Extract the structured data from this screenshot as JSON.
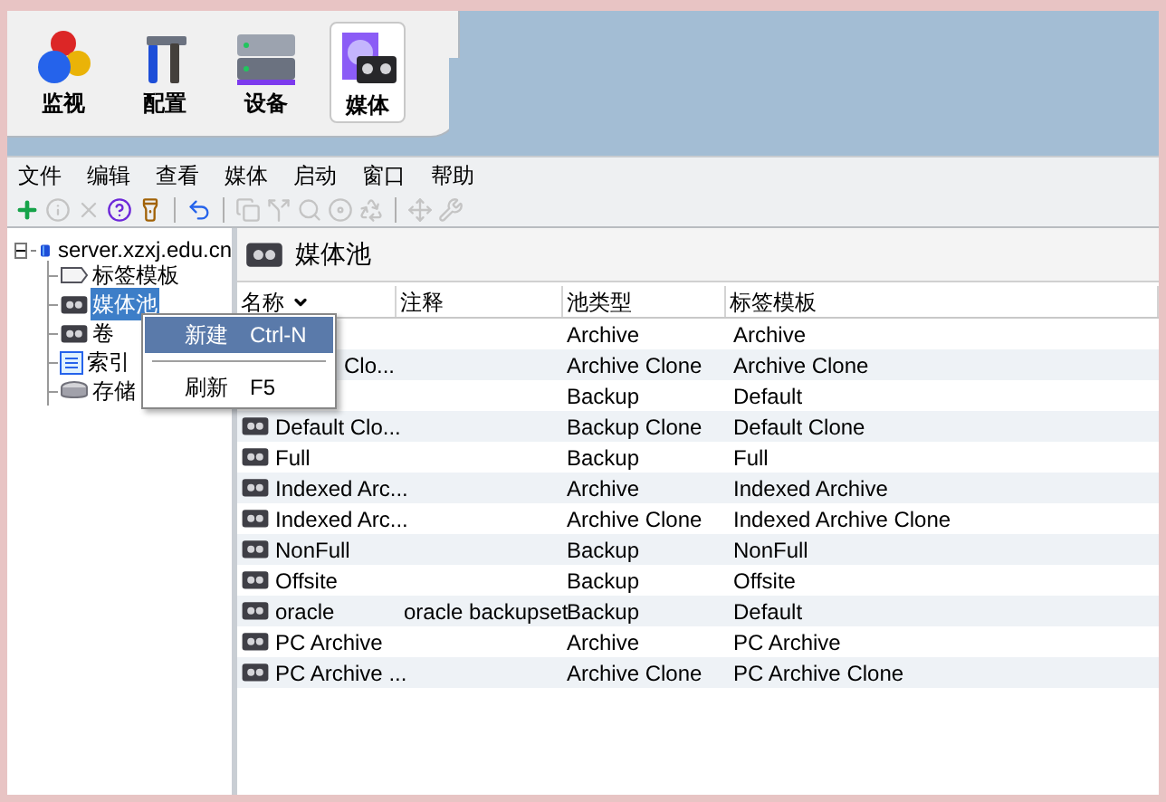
{
  "nav": [
    {
      "label": "监视",
      "kind": "monitor",
      "selected": false
    },
    {
      "label": "配置",
      "kind": "config",
      "selected": false
    },
    {
      "label": "设备",
      "kind": "device",
      "selected": false
    },
    {
      "label": "媒体",
      "kind": "media",
      "selected": true
    }
  ],
  "menu": [
    "文件",
    "编辑",
    "查看",
    "媒体",
    "启动",
    "窗口",
    "帮助"
  ],
  "toolbar": [
    {
      "kind": "add",
      "disabled": false
    },
    {
      "kind": "info",
      "disabled": true
    },
    {
      "kind": "delete",
      "disabled": true
    },
    {
      "kind": "help",
      "disabled": false
    },
    {
      "kind": "light",
      "disabled": false
    },
    {
      "kind": "sep"
    },
    {
      "kind": "undo",
      "disabled": false
    },
    {
      "kind": "sep"
    },
    {
      "kind": "copy",
      "disabled": true
    },
    {
      "kind": "split",
      "disabled": true
    },
    {
      "kind": "search",
      "disabled": true
    },
    {
      "kind": "disc",
      "disabled": true
    },
    {
      "kind": "recycle",
      "disabled": true
    },
    {
      "kind": "sep"
    },
    {
      "kind": "move",
      "disabled": true
    },
    {
      "kind": "tool",
      "disabled": true
    }
  ],
  "tree": {
    "label": "server.xzxj.edu.cn",
    "expanded": true,
    "children": [
      {
        "label": "标签模板",
        "kind": "label",
        "selected": false
      },
      {
        "label": "媒体池",
        "kind": "tape",
        "selected": true
      },
      {
        "label": "卷",
        "kind": "tape",
        "selected": false
      },
      {
        "label": "索引",
        "kind": "index",
        "selected": false
      },
      {
        "label": "存储",
        "kind": "storage",
        "selected": false
      }
    ]
  },
  "panel": {
    "title": "媒体池"
  },
  "table": {
    "columns": [
      "名称",
      "注释",
      "池类型",
      "标签模板"
    ],
    "rows": [
      {
        "kind": "covered",
        "pool_type": "Archive",
        "label_template": "Archive"
      },
      {
        "kind": "covered",
        "name": "Clo...",
        "pool_type": "Archive Clone",
        "label_template": "Archive Clone"
      },
      {
        "kind": "covered",
        "pool_type": "Backup",
        "label_template": "Default"
      },
      {
        "kind": "plain",
        "name": "Default Clo...",
        "pool_type": "Backup Clone",
        "label_template": "Default Clone"
      },
      {
        "kind": "plain",
        "name": "Full",
        "pool_type": "Backup",
        "label_template": "Full"
      },
      {
        "kind": "plain",
        "name": "Indexed Arc...",
        "pool_type": "Archive",
        "label_template": "Indexed Archive"
      },
      {
        "kind": "plain",
        "name": "Indexed Arc...",
        "pool_type": "Archive Clone",
        "label_template": "Indexed Archive Clone"
      },
      {
        "kind": "plain",
        "name": "NonFull",
        "pool_type": "Backup",
        "label_template": "NonFull"
      },
      {
        "kind": "plain",
        "name": "Offsite",
        "pool_type": "Backup",
        "label_template": "Offsite"
      },
      {
        "kind": "plain",
        "name": "oracle",
        "comment": "oracle backupset",
        "pool_type": "Backup",
        "label_template": "Default"
      },
      {
        "kind": "plain",
        "name": "PC Archive",
        "pool_type": "Archive",
        "label_template": "PC Archive"
      },
      {
        "kind": "plain",
        "name": "PC Archive ...",
        "pool_type": "Archive Clone",
        "label_template": "PC Archive Clone"
      }
    ]
  },
  "context_menu": [
    {
      "label": "新建",
      "shortcut": "Ctrl-N",
      "selected": true
    },
    {
      "kind": "sep"
    },
    {
      "label": "刷新",
      "shortcut": "F5",
      "selected": false
    }
  ]
}
